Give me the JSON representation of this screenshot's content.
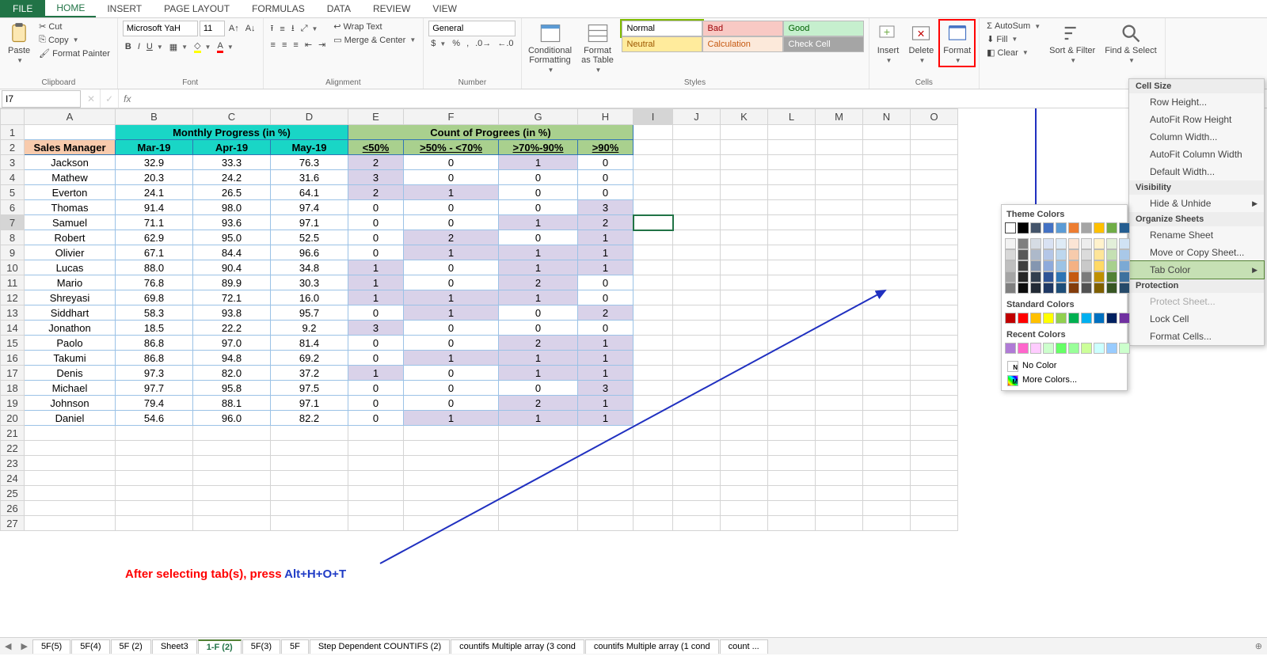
{
  "ribbon_tabs": {
    "file": "FILE",
    "home": "HOME",
    "insert": "INSERT",
    "page_layout": "PAGE LAYOUT",
    "formulas": "FORMULAS",
    "data": "DATA",
    "review": "REVIEW",
    "view": "VIEW"
  },
  "clipboard": {
    "paste": "Paste",
    "cut": "Cut",
    "copy": "Copy",
    "painter": "Format Painter",
    "label": "Clipboard"
  },
  "font": {
    "family": "Microsoft YaH",
    "size": "11",
    "label": "Font"
  },
  "alignment": {
    "wrap": "Wrap Text",
    "merge": "Merge & Center",
    "label": "Alignment"
  },
  "number": {
    "format": "General",
    "label": "Number"
  },
  "cond": {
    "cf": "Conditional Formatting",
    "fat": "Format as Table",
    "label": "Styles"
  },
  "styles": {
    "normal": "Normal",
    "bad": "Bad",
    "good": "Good",
    "neutral": "Neutral",
    "calc": "Calculation",
    "check": "Check Cell"
  },
  "cells": {
    "insert": "Insert",
    "delete": "Delete",
    "format": "Format",
    "label": "Cells"
  },
  "editing": {
    "autosum": "AutoSum",
    "fill": "Fill",
    "clear": "Clear",
    "sort": "Sort & Filter",
    "find": "Find & Select"
  },
  "namebox": "I7",
  "format_menu": {
    "cellsize": "Cell Size",
    "rowh": "Row Height...",
    "autorow": "AutoFit Row Height",
    "colw": "Column Width...",
    "autocol": "AutoFit Column Width",
    "defw": "Default Width...",
    "visibility": "Visibility",
    "hide": "Hide & Unhide",
    "organize": "Organize Sheets",
    "rename": "Rename Sheet",
    "move": "Move or Copy Sheet...",
    "tabcolor": "Tab Color",
    "protection": "Protection",
    "protect": "Protect Sheet...",
    "lock": "Lock Cell",
    "fcells": "Format Cells..."
  },
  "color_picker": {
    "theme": "Theme Colors",
    "standard": "Standard Colors",
    "recent": "Recent Colors",
    "nocolor": "No Color",
    "more": "More Colors...",
    "n_badge": "N",
    "m_badge": "M"
  },
  "grid": {
    "cols": [
      "A",
      "B",
      "C",
      "D",
      "E",
      "F",
      "G",
      "H",
      "I",
      "J",
      "K",
      "L",
      "M",
      "N",
      "O"
    ],
    "h_monthly": "Monthly Progress (in %)",
    "h_count": "Count of Progrees (in %)",
    "h_sales": "Sales Manager",
    "months": [
      "Mar-19",
      "Apr-19",
      "May-19"
    ],
    "ranges": [
      "<50%",
      ">50% - <70%",
      ">70%-90%",
      ">90%"
    ],
    "rows": [
      {
        "name": "Jackson",
        "m": [
          32.9,
          33.3,
          76.3
        ],
        "c": [
          2,
          0,
          1,
          0
        ],
        "h": [
          1,
          0,
          1,
          0
        ]
      },
      {
        "name": "Mathew",
        "m": [
          20.3,
          24.2,
          31.6
        ],
        "c": [
          3,
          0,
          0,
          0
        ],
        "h": [
          1,
          0,
          0,
          0
        ]
      },
      {
        "name": "Everton",
        "m": [
          24.1,
          26.5,
          64.1
        ],
        "c": [
          2,
          1,
          0,
          0
        ],
        "h": [
          1,
          1,
          0,
          0
        ]
      },
      {
        "name": "Thomas",
        "m": [
          91.4,
          98.0,
          97.4
        ],
        "c": [
          0,
          0,
          0,
          3
        ],
        "h": [
          0,
          0,
          0,
          1
        ]
      },
      {
        "name": "Samuel",
        "m": [
          71.1,
          93.6,
          97.1
        ],
        "c": [
          0,
          0,
          1,
          2
        ],
        "h": [
          0,
          0,
          1,
          1
        ]
      },
      {
        "name": "Robert",
        "m": [
          62.9,
          95.0,
          52.5
        ],
        "c": [
          0,
          2,
          0,
          1
        ],
        "h": [
          0,
          1,
          0,
          1
        ]
      },
      {
        "name": "Olivier",
        "m": [
          67.1,
          84.4,
          96.6
        ],
        "c": [
          0,
          1,
          1,
          1
        ],
        "h": [
          0,
          1,
          1,
          1
        ]
      },
      {
        "name": "Lucas",
        "m": [
          88.0,
          90.4,
          34.8
        ],
        "c": [
          1,
          0,
          1,
          1
        ],
        "h": [
          1,
          0,
          1,
          1
        ]
      },
      {
        "name": "Mario",
        "m": [
          76.8,
          89.9,
          30.3
        ],
        "c": [
          1,
          0,
          2,
          0
        ],
        "h": [
          1,
          0,
          1,
          0
        ]
      },
      {
        "name": "Shreyasi",
        "m": [
          69.8,
          72.1,
          16.0
        ],
        "c": [
          1,
          1,
          1,
          0
        ],
        "h": [
          1,
          1,
          1,
          0
        ]
      },
      {
        "name": "Siddhart",
        "m": [
          58.3,
          93.8,
          95.7
        ],
        "c": [
          0,
          1,
          0,
          2
        ],
        "h": [
          0,
          1,
          0,
          1
        ]
      },
      {
        "name": "Jonathon",
        "m": [
          18.5,
          22.2,
          9.2
        ],
        "c": [
          3,
          0,
          0,
          0
        ],
        "h": [
          1,
          0,
          0,
          0
        ]
      },
      {
        "name": "Paolo",
        "m": [
          86.8,
          97.0,
          81.4
        ],
        "c": [
          0,
          0,
          2,
          1
        ],
        "h": [
          0,
          0,
          1,
          1
        ]
      },
      {
        "name": "Takumi",
        "m": [
          86.8,
          94.8,
          69.2
        ],
        "c": [
          0,
          1,
          1,
          1
        ],
        "h": [
          0,
          1,
          1,
          1
        ]
      },
      {
        "name": "Denis",
        "m": [
          97.3,
          82.0,
          37.2
        ],
        "c": [
          1,
          0,
          1,
          1
        ],
        "h": [
          1,
          0,
          1,
          1
        ]
      },
      {
        "name": "Michael",
        "m": [
          97.7,
          95.8,
          97.5
        ],
        "c": [
          0,
          0,
          0,
          3
        ],
        "h": [
          0,
          0,
          0,
          1
        ]
      },
      {
        "name": "Johnson",
        "m": [
          79.4,
          88.1,
          97.1
        ],
        "c": [
          0,
          0,
          2,
          1
        ],
        "h": [
          0,
          0,
          1,
          1
        ]
      },
      {
        "name": "Daniel",
        "m": [
          54.6,
          96.0,
          82.2
        ],
        "c": [
          0,
          1,
          1,
          1
        ],
        "h": [
          0,
          1,
          1,
          1
        ]
      }
    ]
  },
  "annotation": {
    "red": "After selecting tab(s), press ",
    "blue": "Alt+H+O+T"
  },
  "sheet_tabs": [
    "5F(5)",
    "5F(4)",
    "5F (2)",
    "Sheet3",
    "1-F (2)",
    "5F(3)",
    "5F",
    "Step Dependent COUNTIFS (2)",
    "countifs Multiple array (3 cond",
    "countifs Multiple array (1 cond",
    "count  ..."
  ],
  "active_sheet_idx": 4,
  "theme_colors_row1": [
    "#ffffff",
    "#000000",
    "#44546a",
    "#4472c4",
    "#5b9bd5",
    "#ed7d31",
    "#a5a5a5",
    "#ffc000",
    "#70ad47",
    "#255e91"
  ],
  "theme_shades": [
    [
      "#f2f2f2",
      "#7f7f7f",
      "#d6dce4",
      "#d9e2f3",
      "#deebf6",
      "#fbe5d5",
      "#ededed",
      "#fff2cc",
      "#e2efd9",
      "#d0e2f4"
    ],
    [
      "#d8d8d8",
      "#595959",
      "#adb9ca",
      "#b4c6e7",
      "#bdd7ee",
      "#f7cbac",
      "#dbdbdb",
      "#fee599",
      "#c5e0b3",
      "#a9c8e8"
    ],
    [
      "#bfbfbf",
      "#3f3f3f",
      "#8496b0",
      "#8eaadb",
      "#9cc3e5",
      "#f4b183",
      "#c9c9c9",
      "#ffd965",
      "#a8d08d",
      "#7ba9d4"
    ],
    [
      "#a5a5a5",
      "#262626",
      "#323f4f",
      "#2f5496",
      "#2e75b5",
      "#c55a11",
      "#7b7b7b",
      "#bf9000",
      "#538135",
      "#3e719e"
    ],
    [
      "#7f7f7f",
      "#0c0c0c",
      "#222a35",
      "#1f3864",
      "#1e4e79",
      "#833c0b",
      "#525252",
      "#7f6000",
      "#375623",
      "#264a69"
    ]
  ],
  "standard_colors": [
    "#c00000",
    "#ff0000",
    "#ffc000",
    "#ffff00",
    "#92d050",
    "#00b050",
    "#00b0f0",
    "#0070c0",
    "#002060",
    "#7030a0"
  ],
  "recent_colors": [
    "#b07bd6",
    "#ff66cc",
    "#ffccff",
    "#ccffcc",
    "#66ff66",
    "#99ff99",
    "#ccff99",
    "#ccffff",
    "#99ccff",
    "#ccffcc"
  ]
}
